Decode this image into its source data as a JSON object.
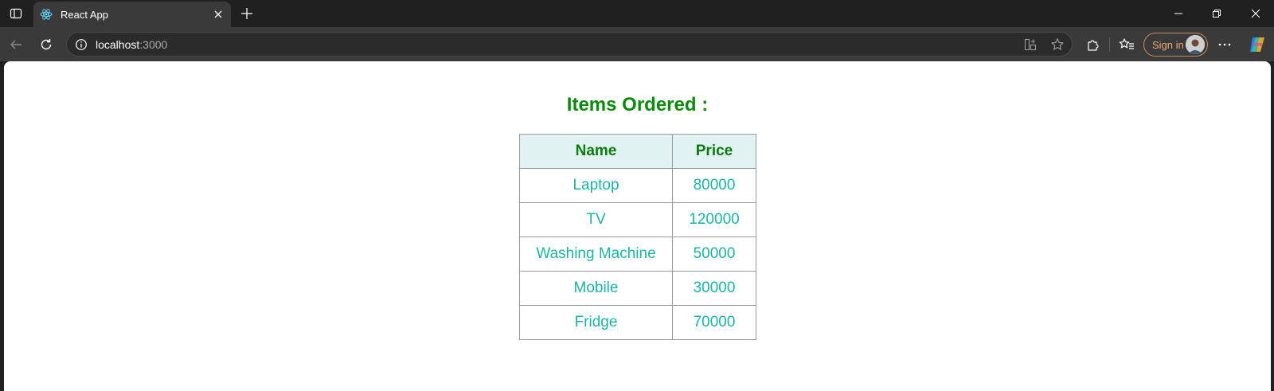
{
  "browser": {
    "tab_title": "React App",
    "url_host": "localhost",
    "url_port": ":3000",
    "signin_label": "Sign in",
    "accent": "#e8a878"
  },
  "icons": {
    "sidebar_toggle": "sidebar-toggle-icon",
    "favicon": "react-logo-icon",
    "tab_close": "close-icon",
    "new_tab": "plus-icon",
    "back": "back-arrow-icon",
    "refresh": "refresh-icon",
    "info": "info-icon",
    "app_available": "app-available-icon",
    "favorite": "star-icon",
    "extensions": "puzzle-icon",
    "favorites": "favorites-icon",
    "more": "more-icon",
    "copilot": "copilot-icon"
  },
  "page": {
    "title": "Items Ordered :",
    "table": {
      "headers": [
        "Name",
        "Price"
      ],
      "rows": [
        [
          "Laptop",
          "80000"
        ],
        [
          "TV",
          "120000"
        ],
        [
          "Washing Machine",
          "50000"
        ],
        [
          "Mobile",
          "30000"
        ],
        [
          "Fridge",
          "70000"
        ]
      ]
    },
    "colors": {
      "title": "#0a8a0a",
      "header_bg": "#e0f2f1",
      "header_text": "#0a7a0a",
      "cell_text": "#20b2a0"
    }
  }
}
